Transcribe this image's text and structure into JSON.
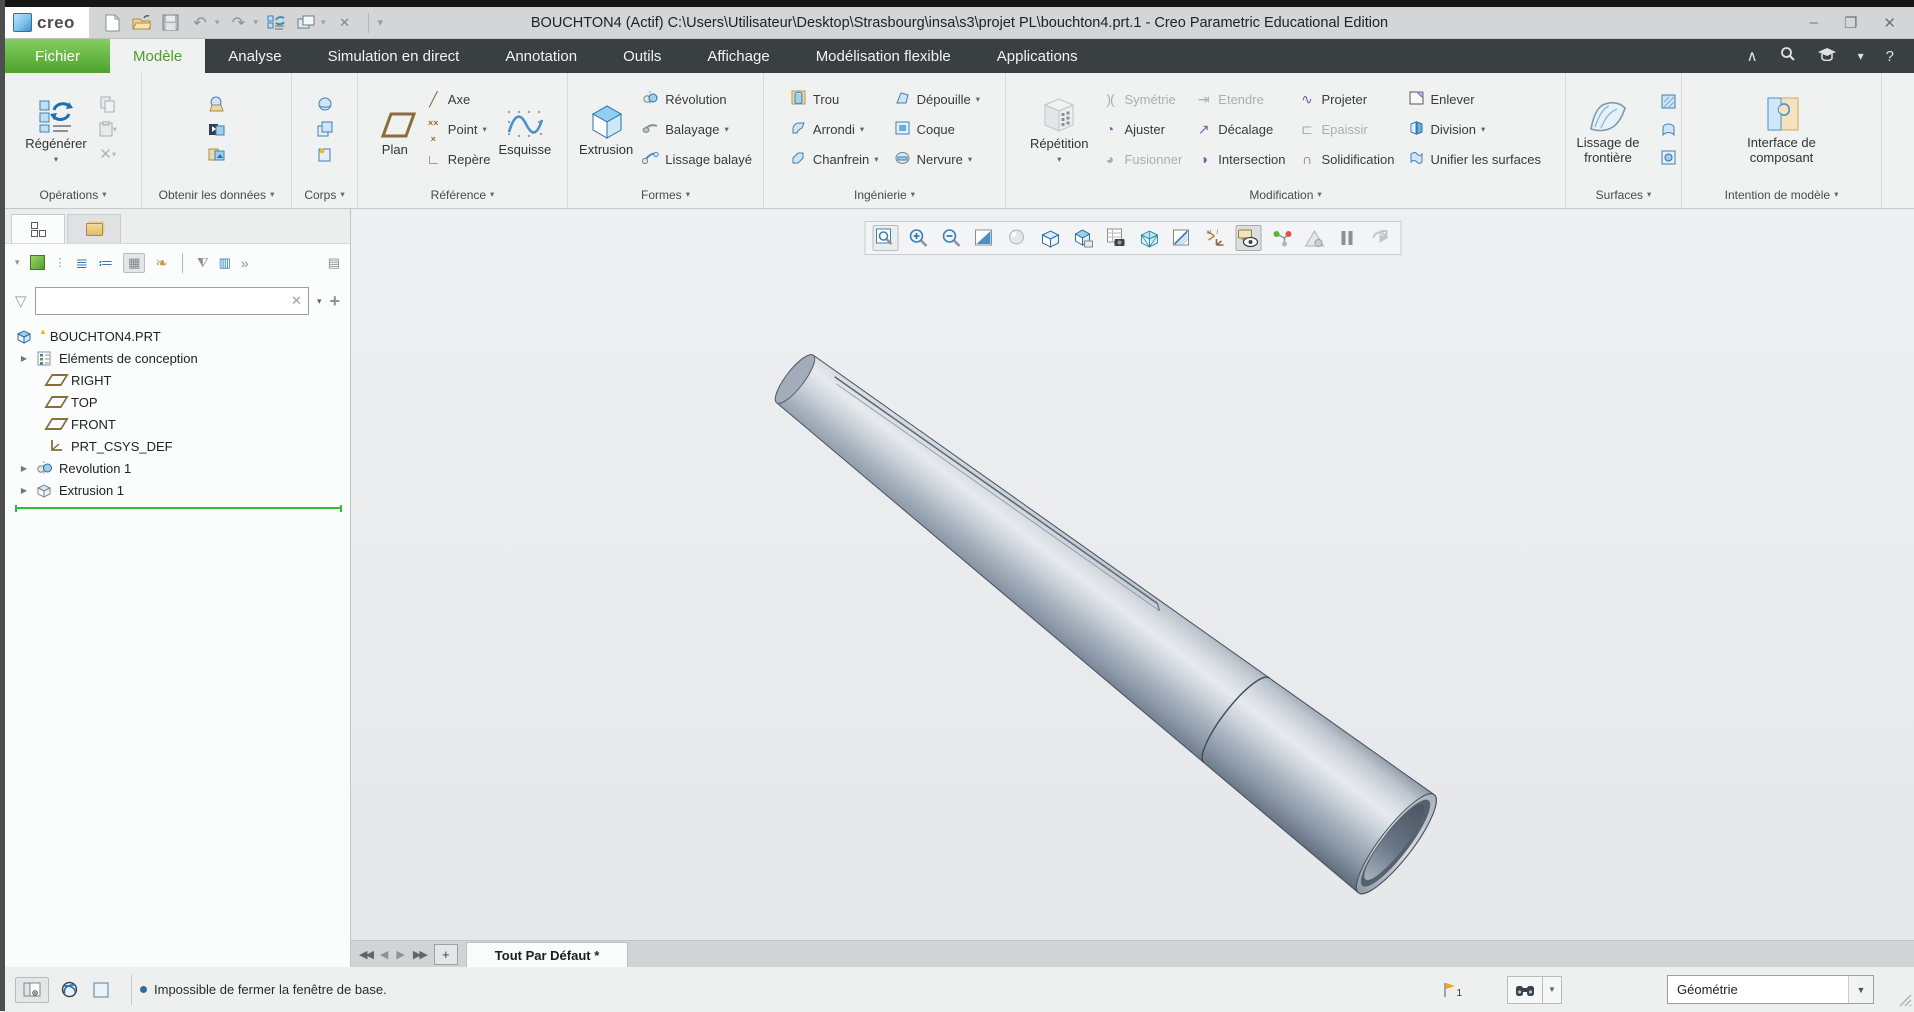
{
  "window": {
    "brand": "creo",
    "title": "BOUCHTON4 (Actif) C:\\Users\\Utilisateur\\Desktop\\Strasbourg\\insa\\s3\\projet PL\\bouchton4.prt.1 - Creo Parametric Educational Edition",
    "controls": {
      "minimize": "–",
      "maximize": "❐",
      "close": "✕"
    }
  },
  "menu_tabs": [
    {
      "label": "Fichier"
    },
    {
      "label": "Modèle"
    },
    {
      "label": "Analyse"
    },
    {
      "label": "Simulation en direct"
    },
    {
      "label": "Annotation"
    },
    {
      "label": "Outils"
    },
    {
      "label": "Affichage"
    },
    {
      "label": "Modélisation flexible"
    },
    {
      "label": "Applications"
    }
  ],
  "ribbon": {
    "groups": [
      {
        "label": "Opérations"
      },
      {
        "label": "Obtenir les données"
      },
      {
        "label": "Corps"
      },
      {
        "label": "Référence"
      },
      {
        "label": "Formes"
      },
      {
        "label": "Ingénierie"
      },
      {
        "label": "Modification"
      },
      {
        "label": "Surfaces"
      },
      {
        "label": "Intention de modèle"
      }
    ],
    "buttons": {
      "regenerer": "Régénérer",
      "plan": "Plan",
      "axe": "Axe",
      "point": "Point",
      "repere": "Repère",
      "esquisse": "Esquisse",
      "extrusion": "Extrusion",
      "revolution": "Révolution",
      "balayage": "Balayage",
      "lissage_balaye": "Lissage balayé",
      "trou": "Trou",
      "arrondi": "Arrondi",
      "chanfrein": "Chanfrein",
      "depouille": "Dépouille",
      "coque": "Coque",
      "nervure": "Nervure",
      "repetition": "Répétition",
      "symetrie": "Symétrie",
      "ajuster": "Ajuster",
      "fusionner": "Fusionner",
      "etendre": "Etendre",
      "decalage": "Décalage",
      "intersection": "Intersection",
      "projeter": "Projeter",
      "epaissir": "Epaissir",
      "solidification": "Solidification",
      "enlever": "Enlever",
      "division": "Division",
      "unifier": "Unifier les surfaces",
      "lissage_frontiere": "Lissage de frontière",
      "interface": "Interface de composant"
    }
  },
  "model_tree": {
    "root": "BOUCHTON4.PRT",
    "items": [
      {
        "label": "Eléments de conception",
        "expandable": true
      },
      {
        "label": "RIGHT"
      },
      {
        "label": "TOP"
      },
      {
        "label": "FRONT"
      },
      {
        "label": "PRT_CSYS_DEF"
      },
      {
        "label": "Revolution 1",
        "expandable": true
      },
      {
        "label": "Extrusion 1",
        "expandable": true
      }
    ]
  },
  "viewport": {
    "orientation_tab": "Tout Par Défaut *",
    "toolbar_icons": [
      "zoom-box",
      "zoom-in",
      "zoom-out",
      "repaint",
      "shading",
      "display-style",
      "saved-orientations",
      "view-manager",
      "perspective",
      "section",
      "datum-display",
      "annotation-display",
      "spin-center",
      "analysis",
      "pause",
      "resume"
    ]
  },
  "statusbar": {
    "message": "Impossible de fermer la fenêtre de base.",
    "flag_count": "1",
    "selection_filter": "Géométrie"
  },
  "colors": {
    "accent_green": "#5cb636",
    "tab_bar": "#3a4041",
    "ribbon_bg": "#f0f1f1",
    "viewport_bg": "#e9ebee",
    "icon_blue": "#3f7fb5",
    "icon_brown": "#8a6d3b",
    "icon_purple": "#7b5ea7",
    "disabled": "#abb1b4",
    "model_steel": "#aab6c4"
  }
}
